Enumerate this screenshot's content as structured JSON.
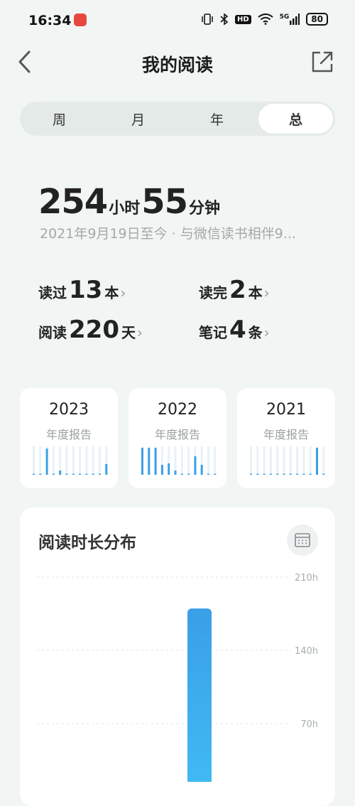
{
  "status": {
    "time": "16:34",
    "network": "5G",
    "hd": "HD",
    "battery": "80"
  },
  "header": {
    "title": "我的阅读"
  },
  "tabs": [
    {
      "label": "周",
      "active": false
    },
    {
      "label": "月",
      "active": false
    },
    {
      "label": "年",
      "active": false
    },
    {
      "label": "总",
      "active": true
    }
  ],
  "total": {
    "hours": "254",
    "hours_unit": "小时",
    "minutes": "55",
    "minutes_unit": "分钟",
    "since": "2021年9月19日至今 · 与微信读书相伴9..."
  },
  "stats": [
    {
      "label": "读过",
      "value": "13",
      "unit": "本"
    },
    {
      "label": "读完",
      "value": "2",
      "unit": "本"
    },
    {
      "label": "阅读",
      "value": "220",
      "unit": "天"
    },
    {
      "label": "笔记",
      "value": "4",
      "unit": "条"
    }
  ],
  "year_cards": [
    {
      "year": "2023",
      "label": "年度报告",
      "bars": [
        0.02,
        0.02,
        0.92,
        0.02,
        0.15,
        0.02,
        0.02,
        0.02,
        0.02,
        0.02,
        0.02,
        0.38
      ]
    },
    {
      "year": "2022",
      "label": "年度报告",
      "bars": [
        0.95,
        0.95,
        0.95,
        0.35,
        0.4,
        0.15,
        0.02,
        0.02,
        0.65,
        0.35,
        0.02,
        0.02
      ]
    },
    {
      "year": "2021",
      "label": "年度报告",
      "bars": [
        0.02,
        0.02,
        0.02,
        0.02,
        0.02,
        0.02,
        0.02,
        0.02,
        0.02,
        0.02,
        0.95,
        0.02
      ]
    }
  ],
  "chevron": "›",
  "colors": {
    "accent": "#3aa1e6",
    "bar_top": "#3a9fe8",
    "bar_bottom": "#42c0f5",
    "bg": "#f1f5f4"
  },
  "distribution": {
    "title": "阅读时长分布",
    "calendar_icon": "calendar-icon",
    "chart_data": {
      "type": "bar",
      "title": "阅读时长分布",
      "y_ticks": [
        "210h",
        "140h",
        "70h"
      ],
      "ylim": [
        0,
        210
      ],
      "values": [
        180
      ]
    }
  }
}
